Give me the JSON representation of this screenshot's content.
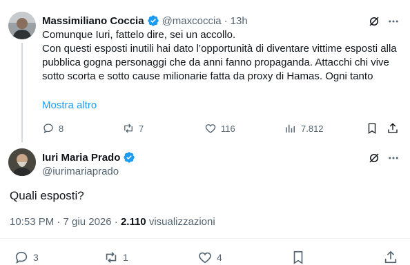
{
  "tweet1": {
    "author_name": "Massimiliano Coccia",
    "author_handle": "@maxcoccia",
    "separator": "·",
    "time": "13h",
    "text": "Comunque Iuri, fattelo dire, sei un accollo.\nCon questi esposti inutili hai dato l’opportunità di diventare vittime esposti alla pubblica gogna personaggi che da anni fanno propaganda. Attacchi chi vive sotto scorta e sotto cause milionarie fatta da proxy di Hamas. Ogni tanto",
    "show_more": "Mostra altro",
    "replies": "8",
    "reposts": "7",
    "likes": "116",
    "views": "7.812"
  },
  "tweet2": {
    "author_name": "Iuri Maria Prado",
    "author_handle": "@iurimariaprado",
    "text": "Quali esposti?",
    "time_date": "10:53 PM · 7 giu 2026 ·",
    "views_count": "2.110",
    "views_label": "visualizzazioni",
    "replies": "3",
    "reposts": "1",
    "likes": "4"
  },
  "colors": {
    "accent": "#1d9bf0",
    "secondary_text": "#536471",
    "text": "#0f1419",
    "divider": "#eff3f4"
  },
  "icons": [
    "grok-icon",
    "more-icon",
    "verified-badge-icon",
    "reply-icon",
    "repost-icon",
    "like-icon",
    "views-icon",
    "bookmark-icon",
    "share-icon"
  ]
}
